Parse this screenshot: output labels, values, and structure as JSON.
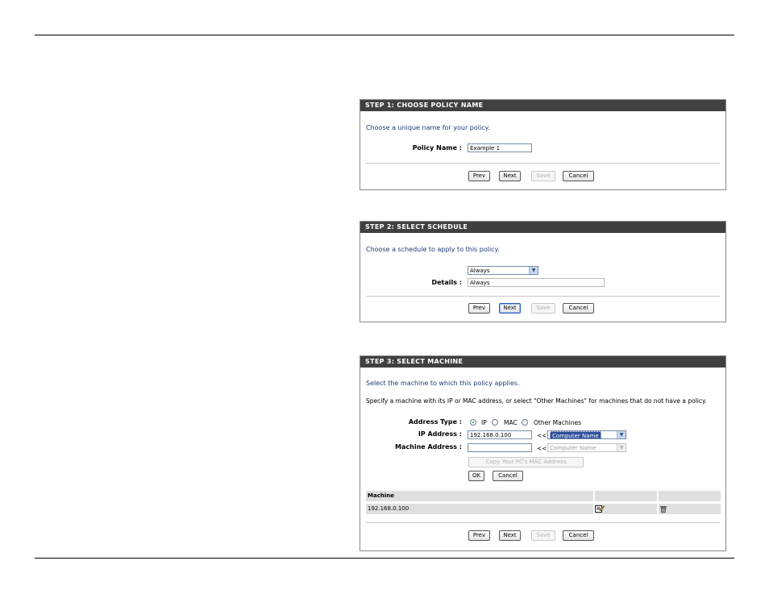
{
  "step1": {
    "title": "STEP 1: CHOOSE POLICY NAME",
    "intro": "Choose a unique name for your policy.",
    "policy_name_label": "Policy Name :",
    "policy_name_value": "Example 1",
    "buttons": {
      "prev": "Prev",
      "next": "Next",
      "save": "Save",
      "cancel": "Cancel"
    }
  },
  "step2": {
    "title": "STEP 2: SELECT SCHEDULE",
    "intro": "Choose a schedule to apply to this policy.",
    "schedule_selected": "Always",
    "details_label": "Details :",
    "details_value": "Always",
    "buttons": {
      "prev": "Prev",
      "next": "Next",
      "save": "Save",
      "cancel": "Cancel"
    }
  },
  "step3": {
    "title": "STEP 3: SELECT MACHINE",
    "intro": "Select the machine to which this policy applies.",
    "description": "Specify a machine with its IP or MAC address, or select \"Other Machines\" for machines that do not have a policy.",
    "address_type_label": "Address Type :",
    "address_type_options": [
      "IP",
      "MAC",
      "Other Machines"
    ],
    "address_type_selected": "IP",
    "ip_address_label": "IP Address :",
    "ip_address_value": "192.168.0.100",
    "ip_arrows": "<<",
    "ip_computer_select": "Computer Name",
    "machine_address_label": "Machine Address :",
    "machine_address_value": "",
    "mac_arrows": "<<",
    "mac_computer_select": "Computer Name",
    "copy_mac_button": "Copy Your PC's MAC Address",
    "ok_button": "OK",
    "cancel_small_button": "Cancel",
    "table": {
      "header": "Machine",
      "rows": [
        "192.168.0.100"
      ]
    },
    "buttons": {
      "prev": "Prev",
      "next": "Next",
      "save": "Save",
      "cancel": "Cancel"
    }
  },
  "icons": {
    "edit": "edit-icon",
    "delete": "trash-icon",
    "dropdown": "chevron-down-icon"
  },
  "colors": {
    "header_bg": "#404040",
    "intro_text": "#1d3a78",
    "table_bg": "#dfdfdf"
  }
}
